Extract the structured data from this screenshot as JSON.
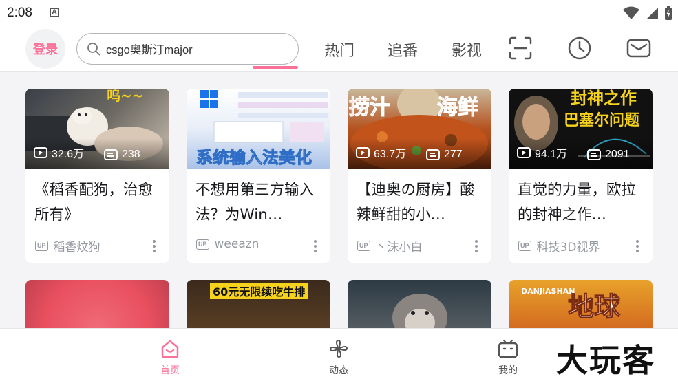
{
  "status_bar": {
    "time": "2:08",
    "notif_glyph": "A"
  },
  "header": {
    "login_label": "登录",
    "search_value": "csgo奥斯汀major",
    "tabs": [
      "热门",
      "追番",
      "影视"
    ],
    "icons": [
      "scan-icon",
      "history-icon",
      "mail-icon"
    ],
    "accent": "#fb7299"
  },
  "cards": [
    {
      "views": "32.6万",
      "danmaku": "238",
      "title": "《稻香配狗，治愈所有》",
      "up": "稻香炆狗",
      "thumb_text": "呜~~"
    },
    {
      "views": "",
      "danmaku": "",
      "title": "不想用第三方输入法？为Win…",
      "up": "weeazn",
      "thumb_text": "系统输入法美化"
    },
    {
      "views": "63.7万",
      "danmaku": "277",
      "title": "【迪奥の厨房】酸辣鲜甜的小…",
      "up": "丶沫小白",
      "thumb_text_left": "捞汁",
      "thumb_text_right": "海鲜"
    },
    {
      "views": "94.1万",
      "danmaku": "2091",
      "title": "直觉的力量，欧拉的封神之作…",
      "up": "科技3D视界",
      "thumb_text_top": "封神之作",
      "thumb_text_bottom": "巴塞尔问题"
    }
  ],
  "cards_row2": [
    {
      "thumb_text": ""
    },
    {
      "thumb_text": "60元无限续吃牛排"
    },
    {
      "thumb_text": ""
    },
    {
      "thumb_text": "地球",
      "thumb_sub": "DANJIASHAN"
    }
  ],
  "up_badge": "UP",
  "bottom_nav": [
    {
      "label": "首页",
      "icon": "home-icon",
      "active": true
    },
    {
      "label": "动态",
      "icon": "fan-icon",
      "active": false
    },
    {
      "label": "我的",
      "icon": "tv-icon",
      "active": false
    }
  ],
  "watermark": "大玩客"
}
